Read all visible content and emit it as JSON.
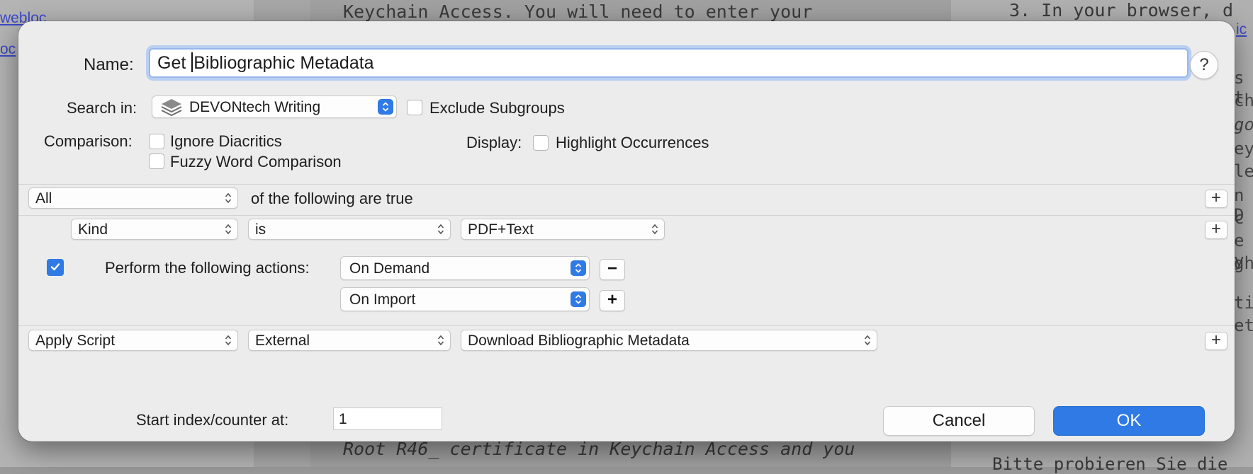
{
  "background": {
    "left_links": [
      "webloc",
      "oc"
    ],
    "mid_top_text": "Keychain Access. You will need to enter your",
    "mid_bottom_text": "Root R46_ certificate in Keychain Access and you",
    "right_top_text": "3.  In your browser, d",
    "right_link": "ic",
    "right_bottom_text": "Bitte probieren Sie die",
    "right_fragments": [
      "s t",
      "ch",
      "go",
      "eyc",
      "let",
      "n D",
      "c",
      "e y",
      "gh",
      "ti",
      "et"
    ]
  },
  "dialog": {
    "name_label": "Name:",
    "name_value_before_caret": "Get ",
    "name_value_after_caret": "Bibliographic Metadata",
    "help_label": "?",
    "search_in_label": "Search in:",
    "search_in_value": "DEVONtech Writing",
    "exclude_subgroups_label": "Exclude Subgroups",
    "exclude_subgroups_checked": false,
    "comparison_label": "Comparison:",
    "ignore_diacritics_label": "Ignore Diacritics",
    "ignore_diacritics_checked": false,
    "fuzzy_label": "Fuzzy Word Comparison",
    "fuzzy_checked": false,
    "display_label": "Display:",
    "highlight_label": "Highlight Occurrences",
    "highlight_checked": false,
    "match_mode": "All",
    "match_suffix": "of the following are true",
    "criterion": {
      "field": "Kind",
      "operator": "is",
      "value": "PDF+Text"
    },
    "perform_checked": true,
    "perform_label": "Perform the following actions:",
    "triggers": [
      "On Demand",
      "On Import"
    ],
    "minus_label": "−",
    "plus_label": "+",
    "action": {
      "type": "Apply Script",
      "source": "External",
      "script": "Download Bibliographic Metadata"
    },
    "counter_label": "Start index/counter at:",
    "counter_value": "1",
    "cancel_label": "Cancel",
    "ok_label": "OK",
    "accent_color": "#2f7ae5"
  }
}
